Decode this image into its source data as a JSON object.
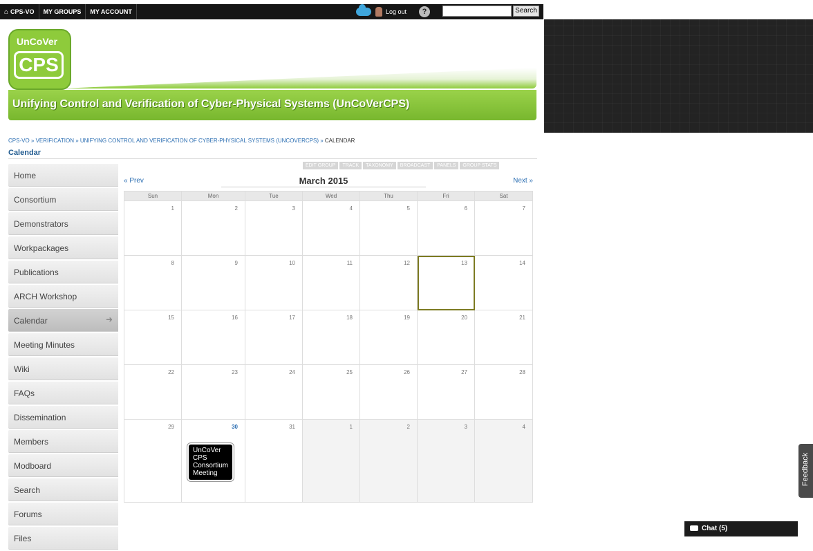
{
  "topbar": {
    "nav": [
      "CPS-VO",
      "MY GROUPS",
      "MY ACCOUNT"
    ],
    "logout": "Log out",
    "help": "?",
    "search_button": "Search",
    "search_value": ""
  },
  "banner": {
    "logo_line1": "UnCoVer",
    "logo_line2": "CPS",
    "title": "Unifying Control and Verification of Cyber-Physical Systems (UnCoVerCPS)"
  },
  "breadcrumb": [
    "CPS-VO",
    "VERIFICATION",
    "UNIFYING CONTROL AND VERIFICATION OF CYBER-PHYSICAL SYSTEMS (UNCOVERCPS)",
    "CALENDAR"
  ],
  "page_title": "Calendar",
  "admin_tabs": [
    "EDIT GROUP",
    "TRACK",
    "TAXONOMY",
    "BROADCAST",
    "PANELS",
    "GROUP STATS"
  ],
  "sidebar": [
    {
      "label": "Home"
    },
    {
      "label": "Consortium"
    },
    {
      "label": "Demonstrators"
    },
    {
      "label": "Workpackages"
    },
    {
      "label": "Publications"
    },
    {
      "label": "ARCH Workshop"
    },
    {
      "label": "Calendar",
      "active": true
    },
    {
      "label": "Meeting Minutes"
    },
    {
      "label": "Wiki"
    },
    {
      "label": "FAQs"
    },
    {
      "label": "Dissemination"
    },
    {
      "label": "Members"
    },
    {
      "label": "Modboard"
    },
    {
      "label": "Search"
    },
    {
      "label": "Forums"
    },
    {
      "label": "Files"
    }
  ],
  "calendar": {
    "prev": "« Prev",
    "next": "Next »",
    "month": "March 2015",
    "weekdays": [
      "Sun",
      "Mon",
      "Tue",
      "Wed",
      "Thu",
      "Fri",
      "Sat"
    ],
    "weeks": [
      [
        "1",
        "2",
        "3",
        "4",
        "5",
        "6",
        "7"
      ],
      [
        "8",
        "9",
        "10",
        "11",
        "12",
        "13",
        "14"
      ],
      [
        "15",
        "16",
        "17",
        "18",
        "19",
        "20",
        "21"
      ],
      [
        "22",
        "23",
        "24",
        "25",
        "26",
        "27",
        "28"
      ],
      [
        "29",
        "30",
        "31",
        "1",
        "2",
        "3",
        "4"
      ]
    ],
    "today": "13",
    "event": {
      "day": "30",
      "text": "UnCoVer CPS Consortium Meeting"
    }
  },
  "feedback": "Feedback",
  "chat": "Chat (5)"
}
